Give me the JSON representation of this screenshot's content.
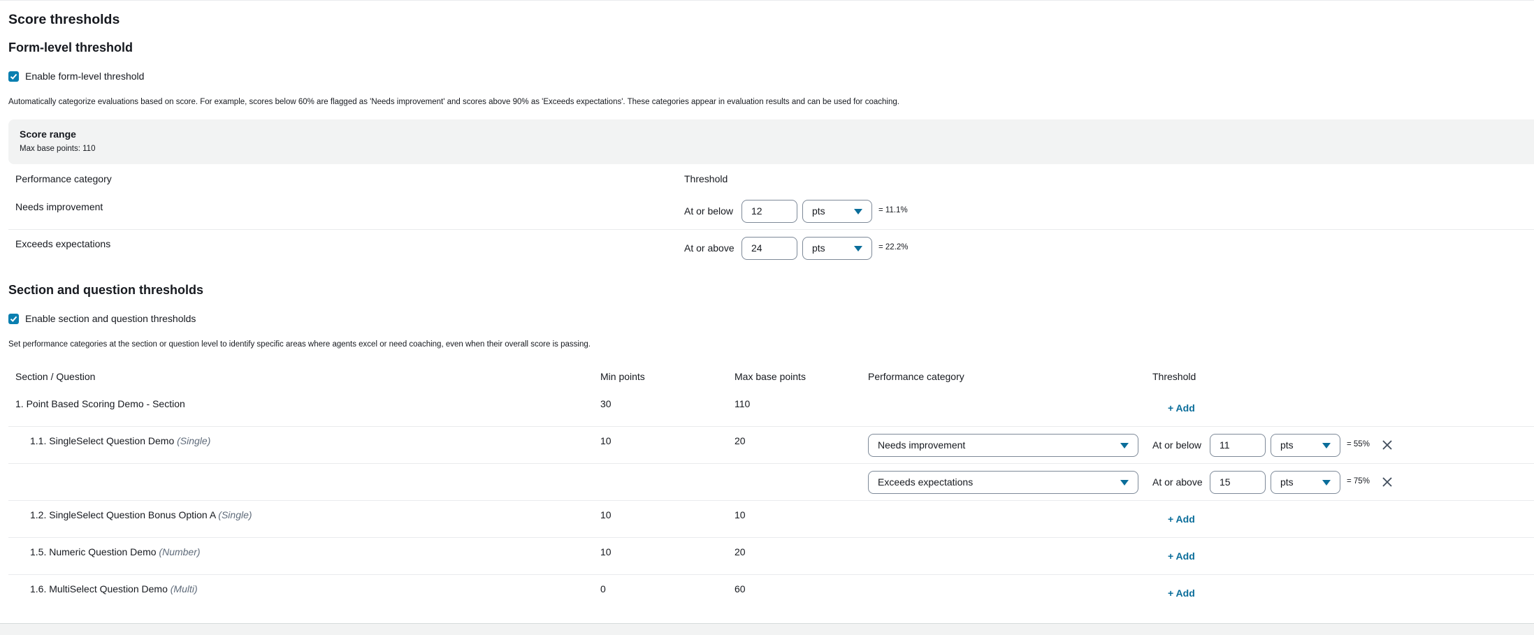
{
  "title": "Score thresholds",
  "form_level": {
    "heading": "Form-level threshold",
    "checkbox_label": "Enable form-level threshold",
    "checked": true,
    "description": "Automatically categorize evaluations based on score. For example, scores below 60% are flagged as 'Needs improvement' and scores above 90% as 'Exceeds expectations'. These categories appear in evaluation results and can be used for coaching.",
    "score_range": {
      "title": "Score range",
      "max_points": "Max base points: 110"
    },
    "columns": {
      "category": "Performance category",
      "threshold": "Threshold"
    },
    "rows": [
      {
        "category": "Needs improvement",
        "comparator": "At or below",
        "value": "12",
        "unit": "pts",
        "percent": "= 11.1%"
      },
      {
        "category": "Exceeds expectations",
        "comparator": "At or above",
        "value": "24",
        "unit": "pts",
        "percent": "= 22.2%"
      }
    ]
  },
  "section_level": {
    "heading": "Section and question thresholds",
    "checkbox_label": "Enable section and question thresholds",
    "checked": true,
    "description": "Set performance categories at the section or question level to identify specific areas where agents excel or need coaching, even when their overall score is passing.",
    "columns": {
      "section": "Section / Question",
      "min": "Min points",
      "max": "Max base points",
      "category": "Performance category",
      "threshold": "Threshold"
    },
    "add_label": "+ Add",
    "rows": [
      {
        "name": "1. Point Based Scoring Demo - Section",
        "type": "",
        "min": "30",
        "max": "110"
      },
      {
        "name": "1.1. SingleSelect Question Demo",
        "type": "(Single)",
        "min": "10",
        "max": "20"
      },
      {
        "name": "1.2. SingleSelect Question Bonus Option A",
        "type": "(Single)",
        "min": "10",
        "max": "10"
      },
      {
        "name": "1.5. Numeric Question Demo",
        "type": "(Number)",
        "min": "10",
        "max": "20"
      },
      {
        "name": "1.6. MultiSelect Question Demo",
        "type": "(Multi)",
        "min": "0",
        "max": "60"
      }
    ],
    "thresholds": [
      {
        "category": "Needs improvement",
        "comparator": "At or below",
        "value": "11",
        "unit": "pts",
        "percent": "= 55%"
      },
      {
        "category": "Exceeds expectations",
        "comparator": "At or above",
        "value": "15",
        "unit": "pts",
        "percent": "= 75%"
      }
    ]
  },
  "colors": {
    "accent": "#0a6d9a",
    "checkbox": "#0a7fb0",
    "panel_bg": "#f2f3f3"
  }
}
